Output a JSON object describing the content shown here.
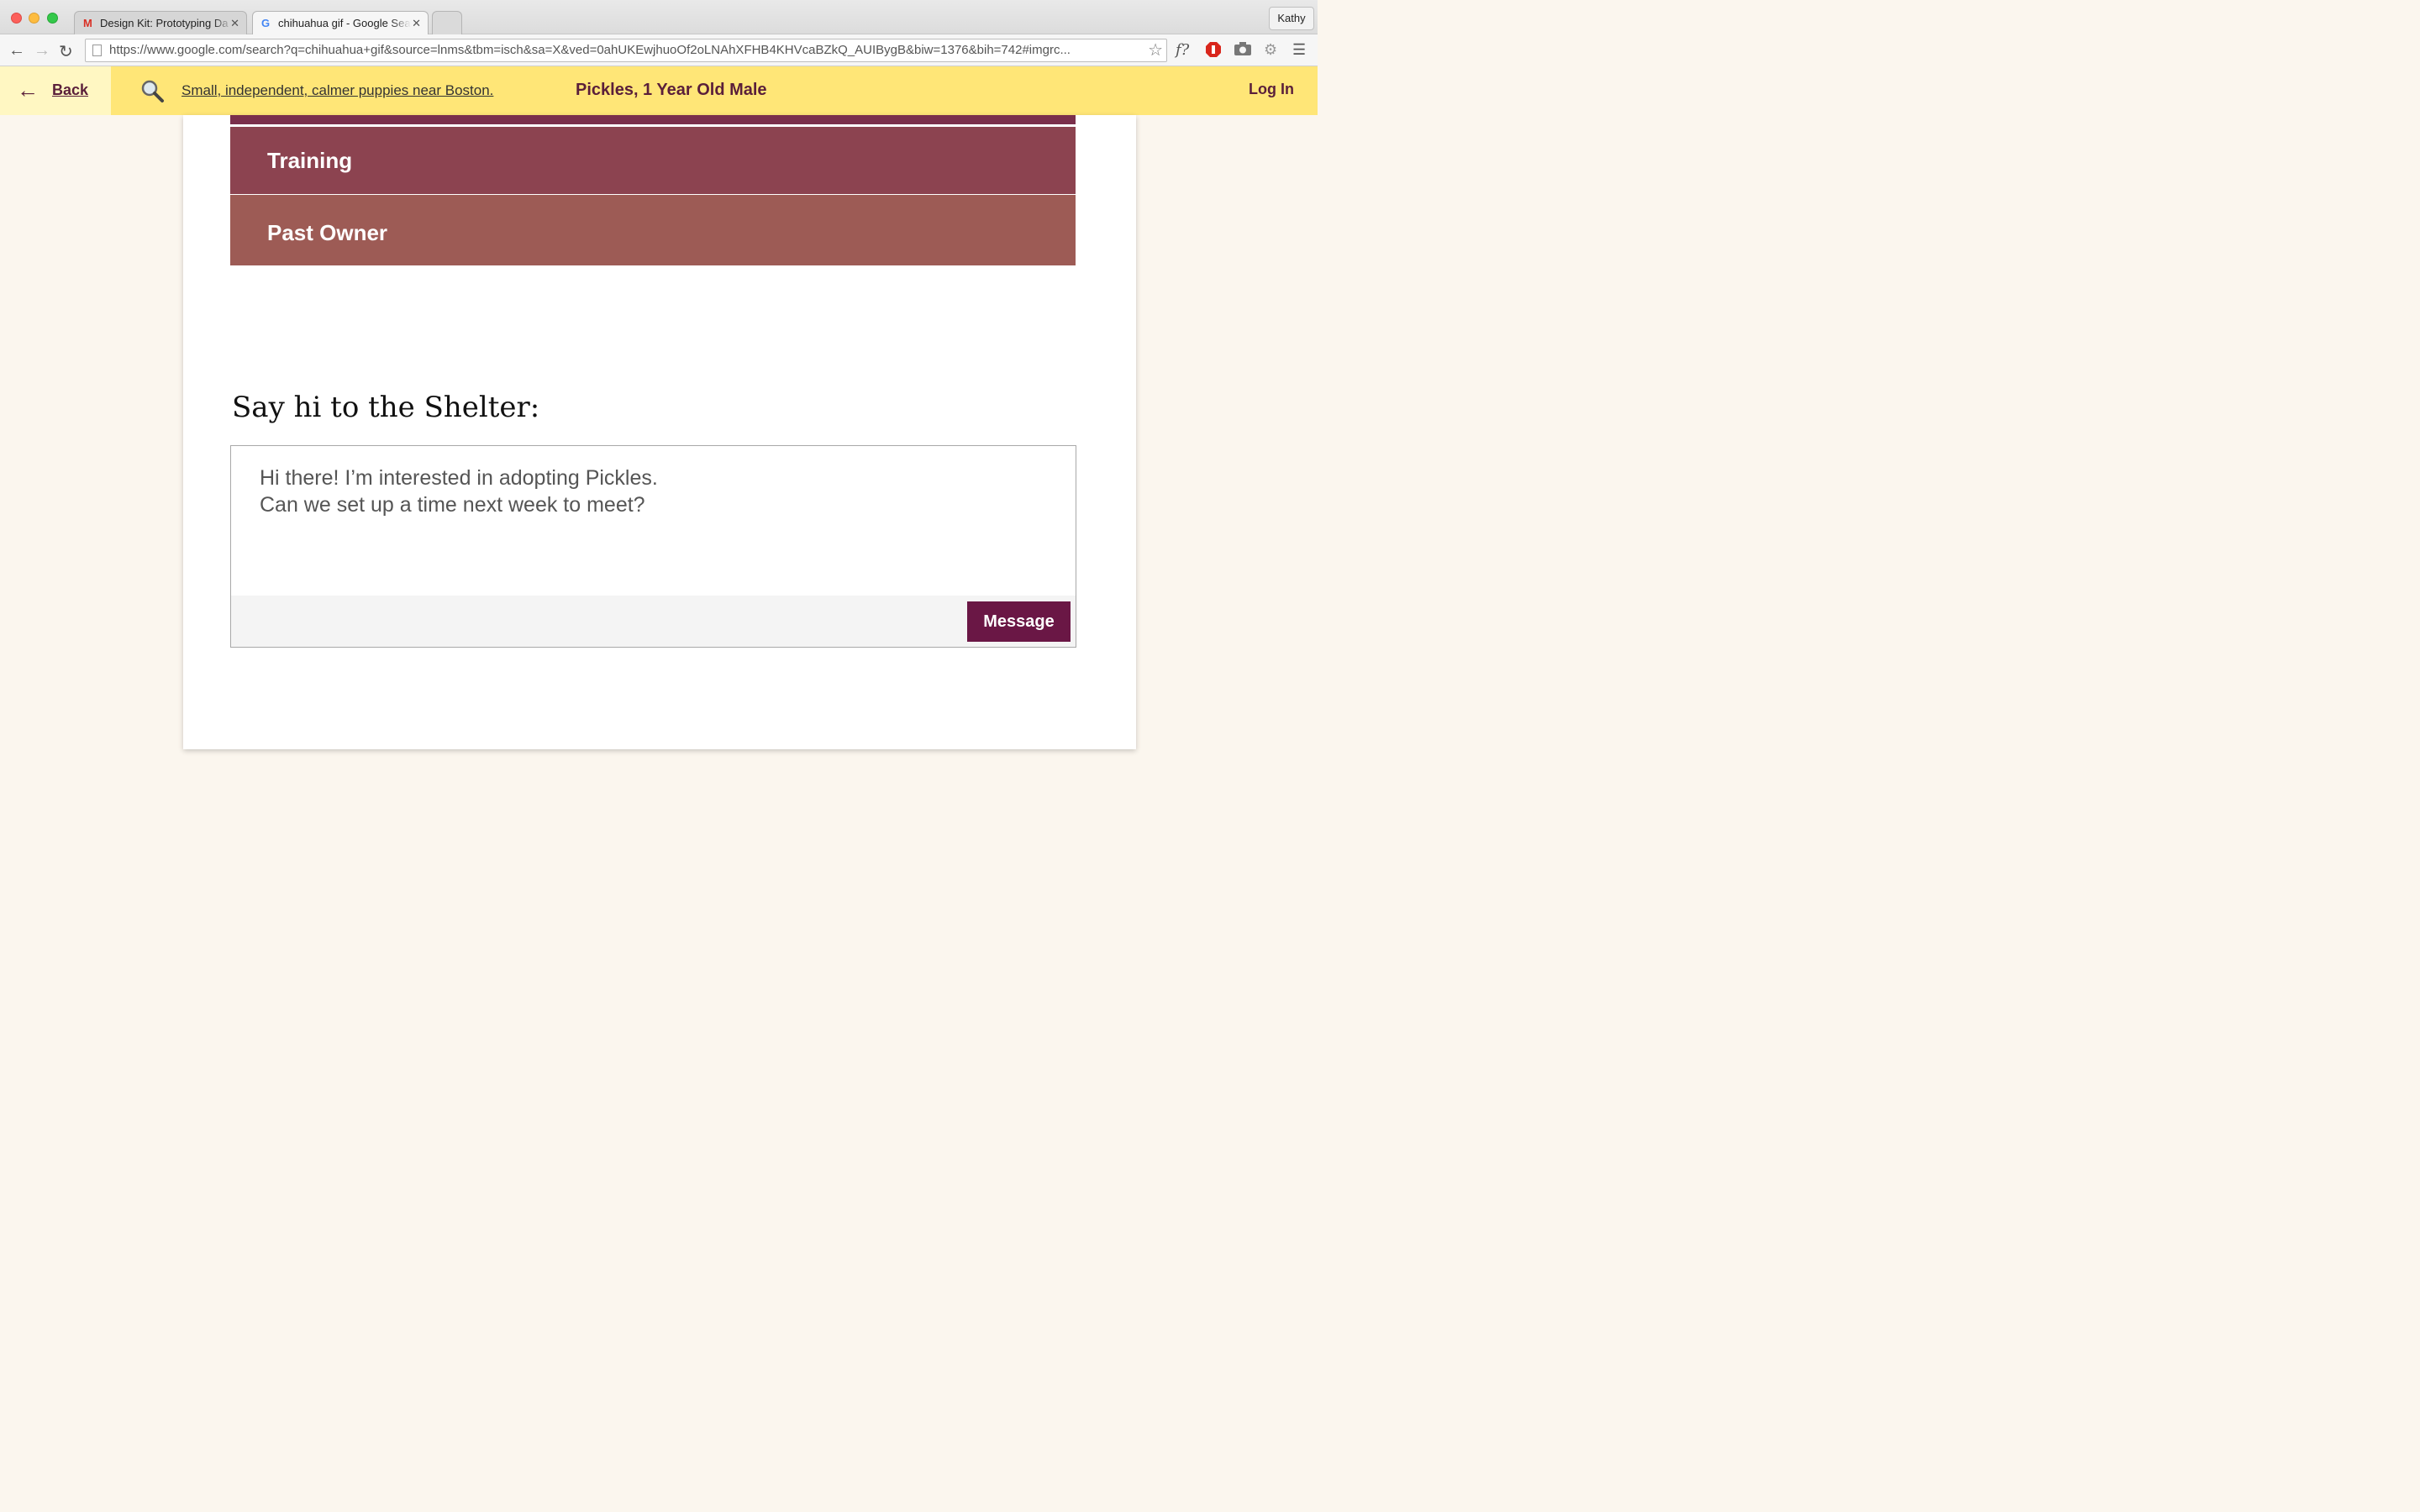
{
  "browser": {
    "tabs": [
      {
        "title": "Design Kit: Prototyping Da",
        "favicon": "gmail-icon"
      },
      {
        "title": "chihuahua gif - Google Sea",
        "favicon": "google-icon",
        "active": true
      }
    ],
    "profile_name": "Kathy",
    "url": "https://www.google.com/search?q=chihuahua+gif&source=lnms&tbm=isch&sa=X&ved=0ahUKEwjhuoOf2oLNAhXFHB4KHVcaBZkQ_AUIBygB&biw=1376&bih=742#imgrc...",
    "extension_f_label": "f?"
  },
  "header": {
    "back_label": "Back",
    "search_query": "Small, independent, calmer puppies near Boston.",
    "pet_title": "Pickles, 1 Year Old Male",
    "login_label": "Log In"
  },
  "sections": [
    {
      "label": "Training",
      "color": "#8c4350"
    },
    {
      "label": "Past Owner",
      "color": "#9d5b55"
    }
  ],
  "message": {
    "heading": "Say hi to the Shelter:",
    "text": "Hi there! I’m interested in adopting Pickles.\nCan we set up a time next week to meet?",
    "button_label": "Message"
  },
  "colors": {
    "accent": "#6a1745",
    "header_bg": "#ffe677",
    "back_bg": "#fff7c2",
    "brand_text": "#5a1f3a"
  }
}
